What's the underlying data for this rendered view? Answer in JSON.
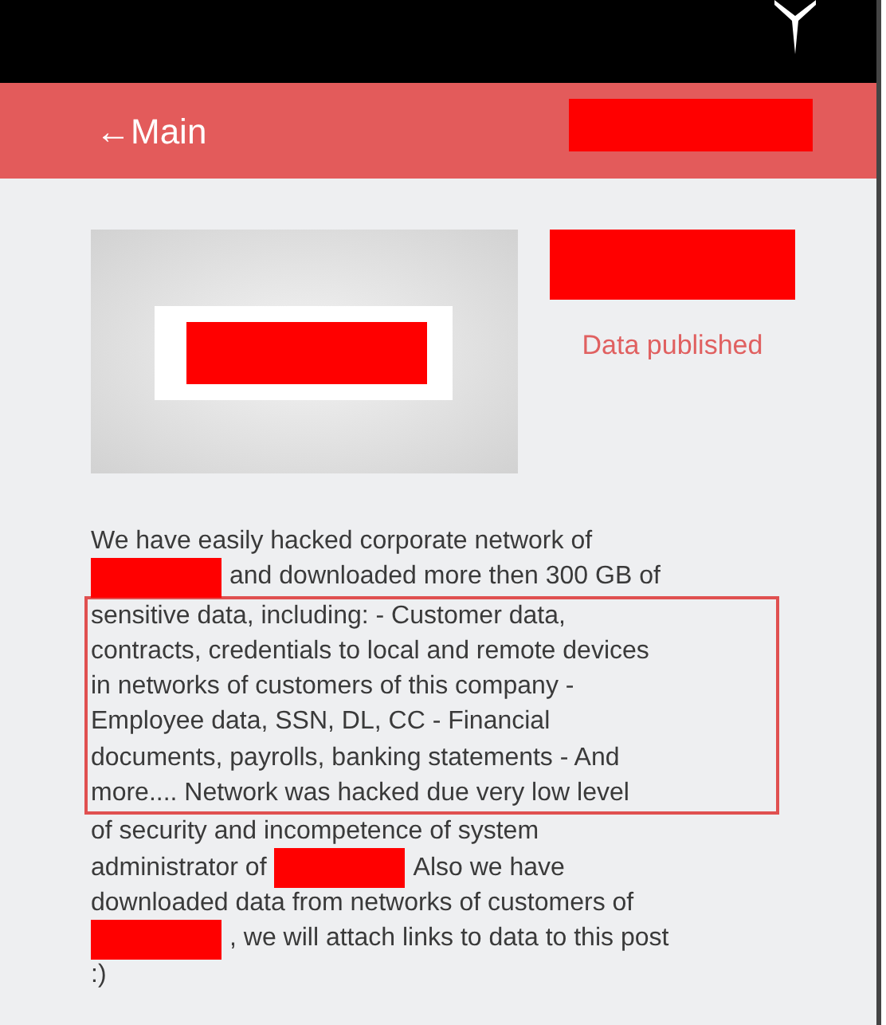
{
  "header": {
    "back_label": "←Main",
    "title": {
      "kind": "redaction"
    }
  },
  "post": {
    "logo_label": {
      "kind": "redaction"
    },
    "title": {
      "kind": "redaction"
    },
    "status": "Data published",
    "body": [
      {
        "highlighted": false,
        "lines": [
          [
            {
              "kind": "text",
              "text": "We have easily hacked corporate network of"
            }
          ],
          [
            {
              "kind": "redaction"
            },
            {
              "kind": "text",
              "text": "and downloaded more then 300 GB of"
            }
          ]
        ]
      },
      {
        "highlighted": true,
        "lines": [
          [
            {
              "kind": "text",
              "text": "sensitive data, including: - Customer data,"
            }
          ],
          [
            {
              "kind": "text",
              "text": "contracts, credentials to local and remote devices"
            }
          ],
          [
            {
              "kind": "text",
              "text": "in networks of customers of this company -"
            }
          ],
          [
            {
              "kind": "text",
              "text": "Employee data, SSN, DL, CC - Financial"
            }
          ],
          [
            {
              "kind": "text",
              "text": "documents, payrolls, banking statements - And"
            }
          ],
          [
            {
              "kind": "text",
              "text": "more....  Network was hacked due very low level"
            }
          ]
        ]
      },
      {
        "highlighted": false,
        "lines": [
          [
            {
              "kind": "text",
              "text": "of security and incompetence of system"
            }
          ],
          [
            {
              "kind": "text",
              "text": "administrator of"
            },
            {
              "kind": "redaction"
            },
            {
              "kind": "text",
              "text": "Also we have"
            }
          ],
          [
            {
              "kind": "text",
              "text": "downloaded data from networks of customers of"
            }
          ],
          [
            {
              "kind": "redaction"
            },
            {
              "kind": "text",
              "text": ", we will attach links to data to this post"
            }
          ],
          [
            {
              "kind": "text",
              "text": ":)"
            }
          ]
        ]
      }
    ]
  }
}
